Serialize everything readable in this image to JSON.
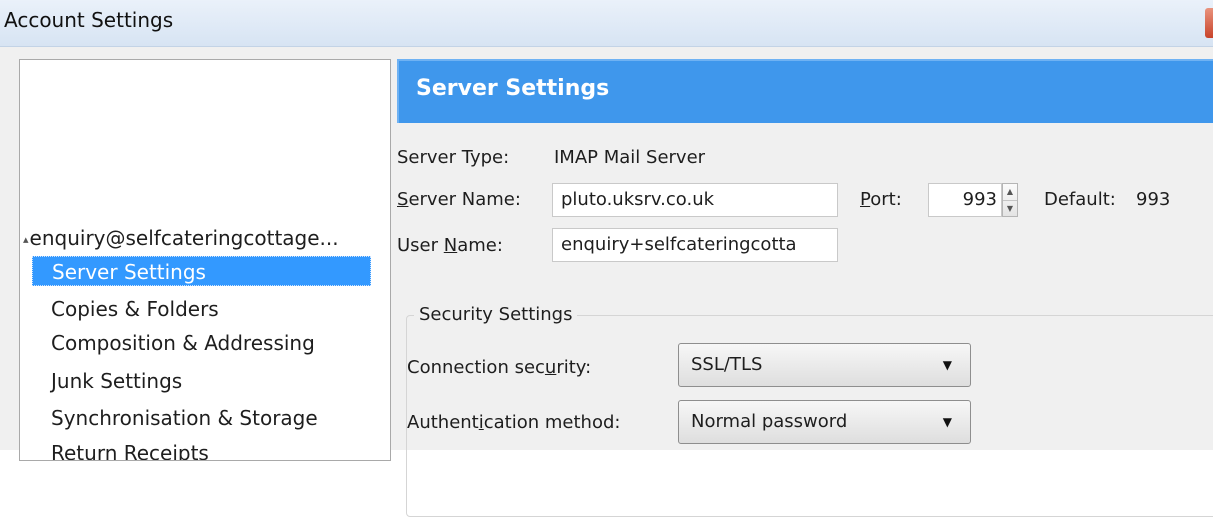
{
  "window": {
    "title": "Account Settings"
  },
  "tree": {
    "account": "enquiry@selfcateringcottage...",
    "items": [
      {
        "label": "Server Settings",
        "selected": true
      },
      {
        "label": "Copies & Folders",
        "selected": false
      },
      {
        "label": "Composition & Addressing",
        "selected": false
      },
      {
        "label": "Junk Settings",
        "selected": false
      },
      {
        "label": "Synchronisation & Storage",
        "selected": false
      },
      {
        "label": "Return Receipts",
        "selected": false
      }
    ]
  },
  "panel": {
    "title": "Server Settings",
    "server_type_label": "Server Type:",
    "server_type_value": "IMAP Mail Server",
    "server_name_label_u": "S",
    "server_name_label_rest": "erver Name:",
    "server_name_value": "pluto.uksrv.co.uk",
    "port_label_u": "P",
    "port_label_rest": "ort:",
    "port_value": "993",
    "default_label": "Default:",
    "default_value": "993",
    "user_name_label_pre": "User ",
    "user_name_label_u": "N",
    "user_name_label_rest": "ame:",
    "user_name_value": "enquiry+selfcateringcotta"
  },
  "security": {
    "legend": "Security Settings",
    "connection_label_pre": "Connection sec",
    "connection_label_u": "u",
    "connection_label_rest": "rity:",
    "connection_value": "SSL/TLS",
    "auth_label_pre": "Authent",
    "auth_label_u": "i",
    "auth_label_rest": "cation method:",
    "auth_value": "Normal password"
  },
  "icons": {
    "tree_expander": "▴",
    "spinner_up": "▲",
    "spinner_down": "▼",
    "dropdown_caret": "▼"
  },
  "colors": {
    "header_blue": "#3f97ec",
    "selection_blue": "#3399ff",
    "titlebar": "#dfe9f5"
  }
}
